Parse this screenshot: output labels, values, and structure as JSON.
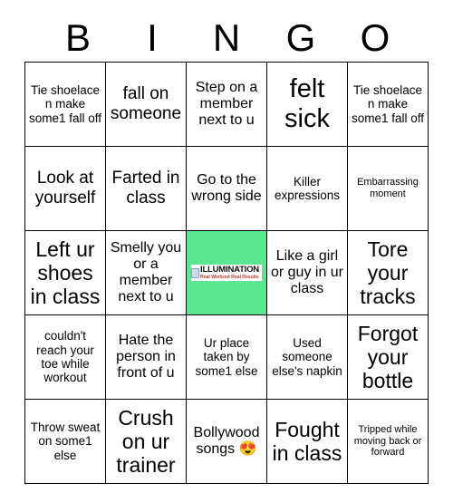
{
  "header": {
    "letters": [
      "B",
      "I",
      "N",
      "G",
      "O"
    ]
  },
  "colors": {
    "free_space_background": "#5de68f",
    "grid_line": "#000000",
    "text": "#000000",
    "logo_tagline": "#c0392b"
  },
  "free_space": {
    "logo_name": "ILLUMINATION",
    "logo_tagline": "Real Workout Real Results"
  },
  "grid": {
    "rows": [
      [
        {
          "text": "Tie shoelace n make some1 fall off",
          "size": "fs-s"
        },
        {
          "text": "fall on someone",
          "size": "fs-l"
        },
        {
          "text": "Step on a member next to u",
          "size": "fs-m"
        },
        {
          "text": "felt sick",
          "size": "fs-xxl"
        },
        {
          "text": "Tie shoelace n make some1 fall off",
          "size": "fs-s"
        }
      ],
      [
        {
          "text": "Look at yourself",
          "size": "fs-l"
        },
        {
          "text": "Farted in class",
          "size": "fs-l"
        },
        {
          "text": "Go to the wrong side",
          "size": "fs-m"
        },
        {
          "text": "Killer expressions",
          "size": "fs-s"
        },
        {
          "text": "Embarrassing moment",
          "size": "fs-xs"
        }
      ],
      [
        {
          "text": "Left ur shoes in class",
          "size": "fs-xl"
        },
        {
          "text": "Smelly you or a member next to u",
          "size": "fs-m"
        },
        {
          "text": "",
          "size": "fs-m",
          "free": true
        },
        {
          "text": "Like a girl or guy in ur class",
          "size": "fs-m"
        },
        {
          "text": "Tore your tracks",
          "size": "fs-xl"
        }
      ],
      [
        {
          "text": "couldn't reach your toe while workout",
          "size": "fs-s"
        },
        {
          "text": "Hate the person in front of u",
          "size": "fs-m"
        },
        {
          "text": "Ur place taken by some1 else",
          "size": "fs-s"
        },
        {
          "text": "Used someone else's napkin",
          "size": "fs-s"
        },
        {
          "text": "Forgot your bottle",
          "size": "fs-xl"
        }
      ],
      [
        {
          "text": "Throw sweat on some1 else",
          "size": "fs-s"
        },
        {
          "text": "Crush on ur trainer",
          "size": "fs-xl"
        },
        {
          "text": "Bollywood songs 😍",
          "size": "fs-m"
        },
        {
          "text": "Fought in class",
          "size": "fs-xl"
        },
        {
          "text": "Tripped while moving back or forward",
          "size": "fs-xs"
        }
      ]
    ]
  }
}
